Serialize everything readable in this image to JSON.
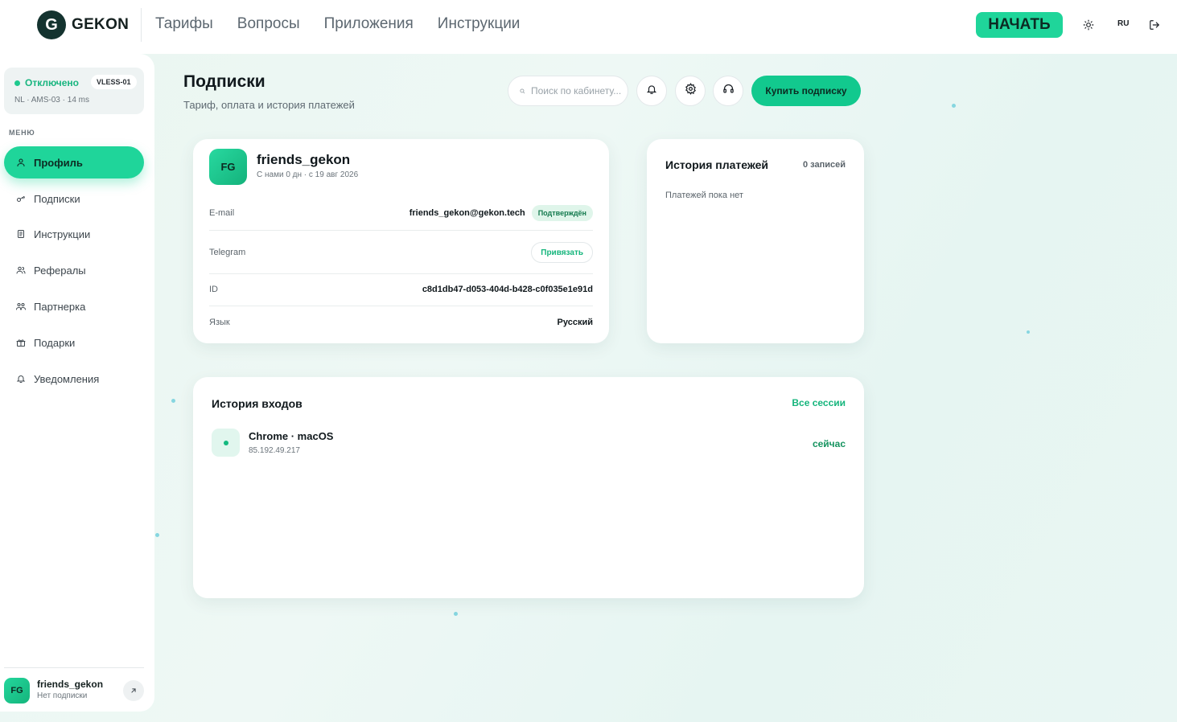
{
  "brand": {
    "name": "GEKON",
    "logo_letter": "G"
  },
  "nav": {
    "links": [
      "Тарифы",
      "Вопросы",
      "Приложения",
      "Инструкции"
    ],
    "start_label": "НАЧАТЬ",
    "lang": "RU"
  },
  "connection": {
    "status": "Отключено",
    "protocol": "VLESS-01",
    "meta": "NL · AMS-03 · 14 ms",
    "status_color": "#1fc98e"
  },
  "sidebar": {
    "menu_title": "МЕНЮ",
    "items": [
      {
        "label": "Профиль",
        "icon": "user-icon",
        "active": true
      },
      {
        "label": "Подписки",
        "icon": "key-icon",
        "active": false
      },
      {
        "label": "Инструкции",
        "icon": "document-icon",
        "active": false
      },
      {
        "label": "Рефералы",
        "icon": "users-icon",
        "active": false
      },
      {
        "label": "Партнерка",
        "icon": "group-icon",
        "active": false
      },
      {
        "label": "Подарки",
        "icon": "gift-icon",
        "active": false
      },
      {
        "label": "Уведомления",
        "icon": "bell-icon",
        "active": false
      }
    ],
    "user": {
      "initials": "FG",
      "name": "friends_gekon",
      "plan": "Нет подписки"
    }
  },
  "header": {
    "title": "Подписки",
    "subtitle": "Тариф, оплата и история платежей",
    "search_placeholder": "Поиск по кабинету...",
    "buy_label": "Купить подписку"
  },
  "profile": {
    "initials": "FG",
    "name": "friends_gekon",
    "since": "С нами 0 дн · с 19 авг 2026",
    "rows": {
      "email_label": "E-mail",
      "email_value": "friends_gekon@gekon.tech",
      "email_badge": "Подтверждён",
      "telegram_label": "Telegram",
      "telegram_action": "Привязать",
      "id_label": "ID",
      "id_value": "c8d1db47-d053-404d-b428-c0f035e1e91d",
      "lang_label": "Язык",
      "lang_value": "Русский"
    }
  },
  "payments": {
    "title": "История платежей",
    "count": "0 записей",
    "empty": "Платежей пока нет"
  },
  "logins": {
    "title": "История входов",
    "all_label": "Все сессии",
    "sessions": [
      {
        "device": "Chrome · macOS",
        "ip": "85.192.49.217",
        "time": "сейчас"
      }
    ]
  },
  "colors": {
    "accent": "#1fd59a",
    "accent_dark": "#12c98e",
    "brand_dark": "#14332f"
  }
}
